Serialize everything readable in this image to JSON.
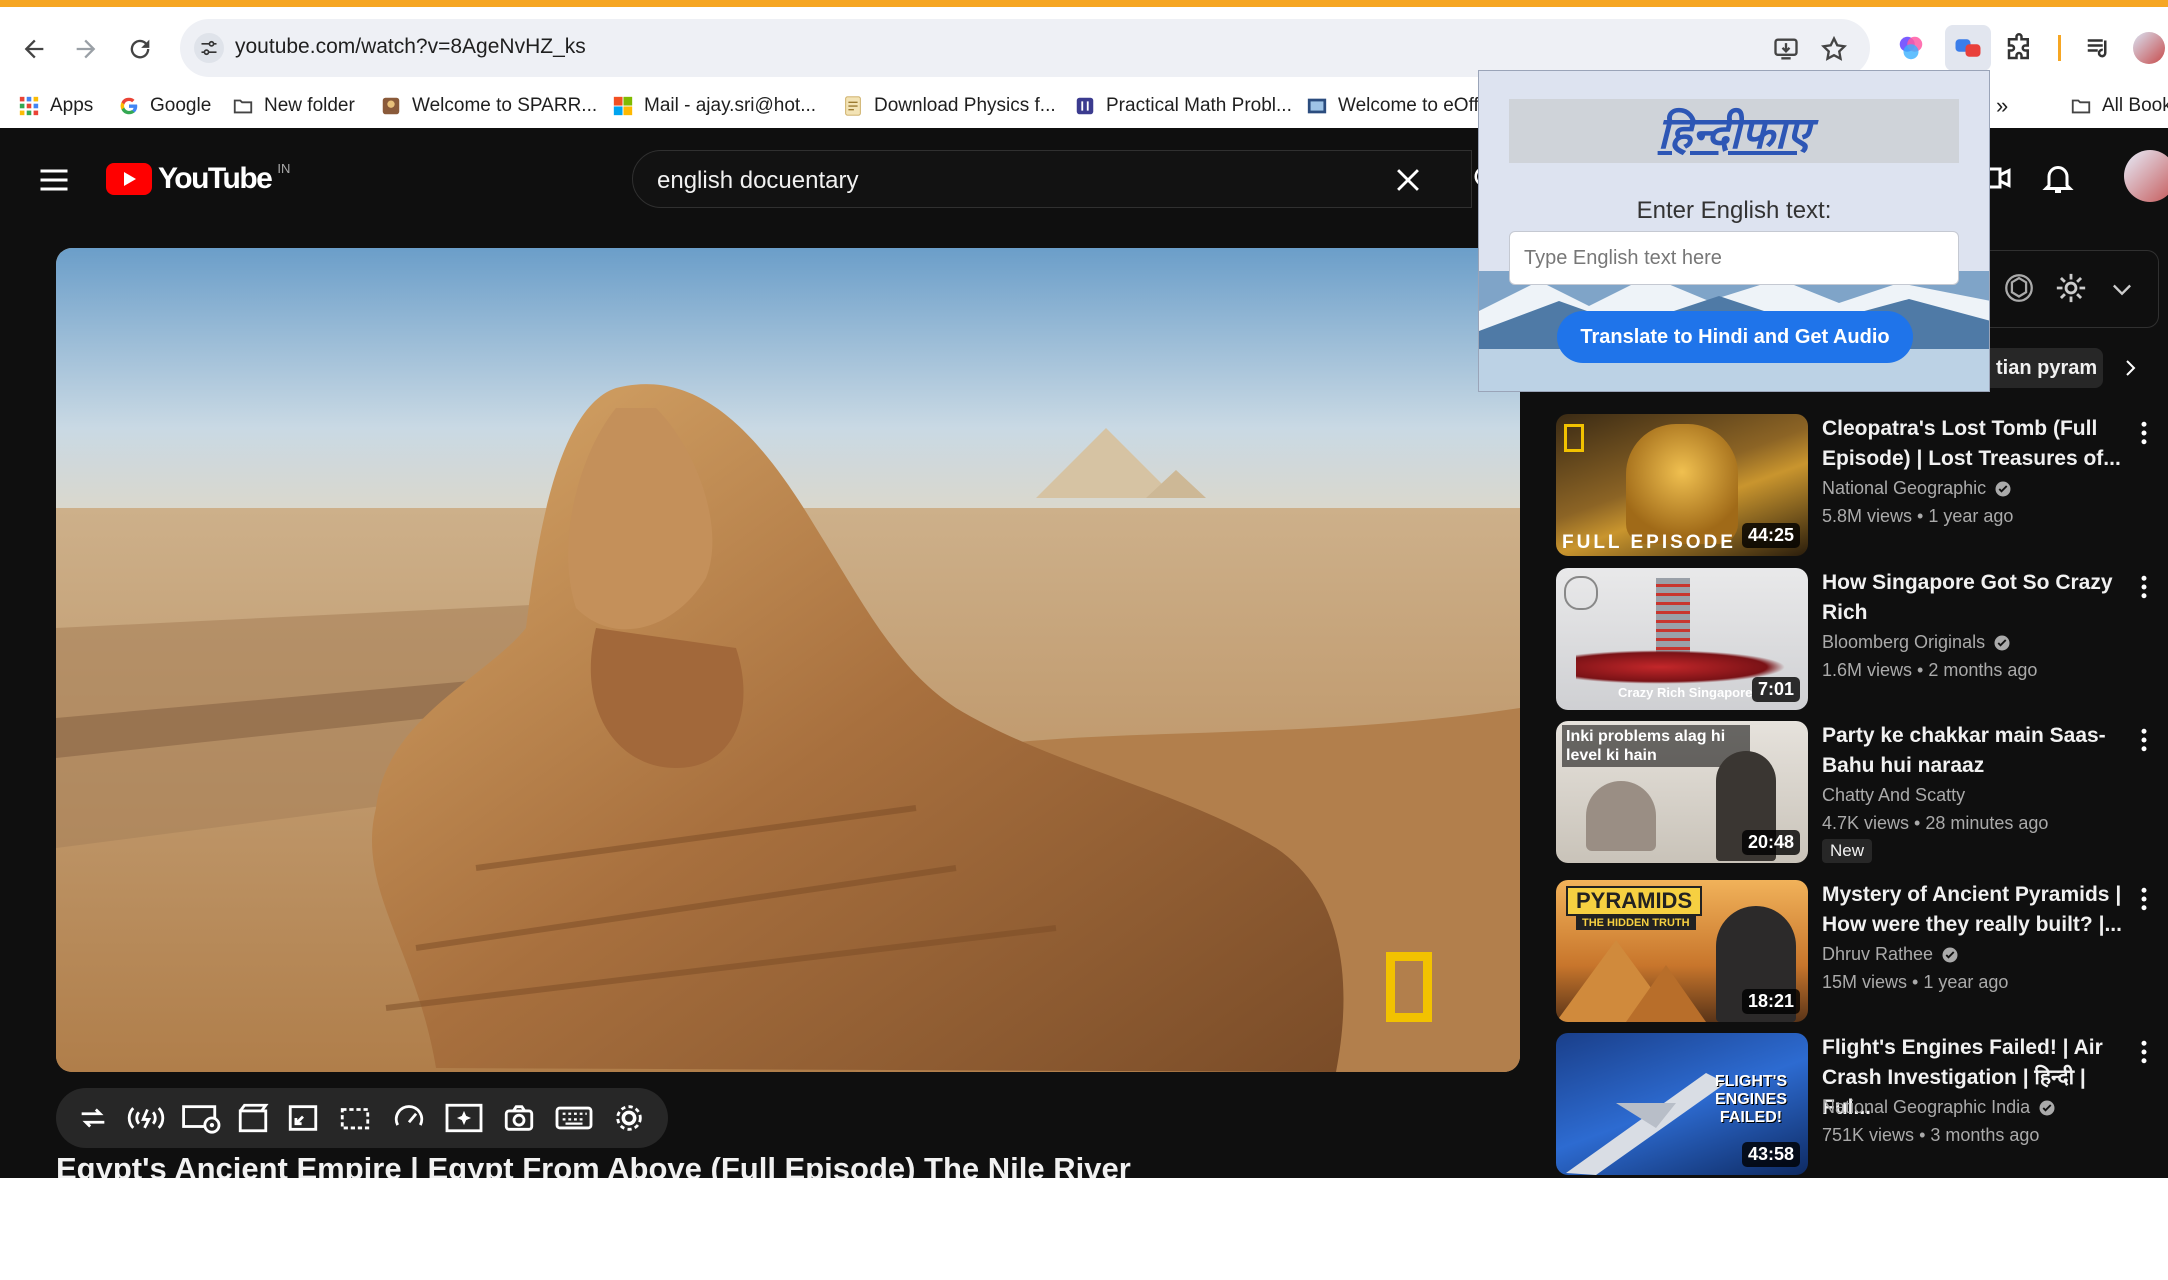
{
  "browser": {
    "url": "youtube.com/watch?v=8AgeNvHZ_ks",
    "bookmarks": [
      {
        "label": "Apps",
        "icon": "apps-grid-icon"
      },
      {
        "label": "Google",
        "icon": "google-icon"
      },
      {
        "label": "New folder",
        "icon": "folder-icon"
      },
      {
        "label": "Welcome to SPARR...",
        "icon": "site-favicon"
      },
      {
        "label": "Mail - ajay.sri@hot...",
        "icon": "microsoft-icon"
      },
      {
        "label": "Download Physics f...",
        "icon": "page-icon"
      },
      {
        "label": "Practical Math Probl...",
        "icon": "site-favicon"
      },
      {
        "label": "Welcome to eOffi",
        "icon": "site-favicon"
      }
    ],
    "all_bookmarks_label": "All Book"
  },
  "youtube": {
    "logo_text": "YouTube",
    "country_code": "IN",
    "search_query": "english docuentary",
    "video_title": "Egypt's Ancient Empire | Egypt From Above (Full Episode) The Nile River",
    "chip_text": "tian pyram",
    "recommendations": [
      {
        "title": "Cleopatra's Lost Tomb (Full Episode) | Lost Treasures of...",
        "channel": "National Geographic",
        "verified": true,
        "views": "5.8M views",
        "age": "1 year ago",
        "duration": "44:25",
        "thumb_text": "FULL EPISODE"
      },
      {
        "title": "How Singapore Got So Crazy Rich",
        "channel": "Bloomberg Originals",
        "verified": true,
        "views": "1.6M views",
        "age": "2 months ago",
        "duration": "7:01",
        "thumb_text": "Crazy Rich Singapore"
      },
      {
        "title": "Party ke chakkar main Saas-Bahu hui naraaz",
        "channel": "Chatty And Scatty",
        "verified": false,
        "views": "4.7K views",
        "age": "28 minutes ago",
        "duration": "20:48",
        "thumb_text": "Inki problems alag hi level ki hain",
        "badge": "New"
      },
      {
        "title": "Mystery of Ancient Pyramids | How were they really built? |...",
        "channel": "Dhruv Rathee",
        "verified": true,
        "views": "15M views",
        "age": "1 year ago",
        "duration": "18:21",
        "thumb_text": "PYRAMIDS",
        "thumb_sub": "THE HIDDEN TRUTH"
      },
      {
        "title": "Flight's Engines Failed! | Air Crash Investigation | हिन्दी | Ful...",
        "channel": "National Geographic India",
        "verified": true,
        "views": "751K views",
        "age": "3 months ago",
        "duration": "43:58",
        "thumb_text": "FLIGHT'S ENGINES FAILED!"
      }
    ]
  },
  "extension_popup": {
    "brand": "हिन्दीफाए",
    "label": "Enter English text:",
    "input_placeholder": "Type English text here",
    "button_label": "Translate to Hindi and Get Audio"
  },
  "colors": {
    "accent_orange": "#f6a623",
    "yt_red": "#ff0000",
    "yt_bg": "#0f0f0f",
    "popup_button": "#1f74ea",
    "natgeo_yellow": "#f2c200"
  }
}
